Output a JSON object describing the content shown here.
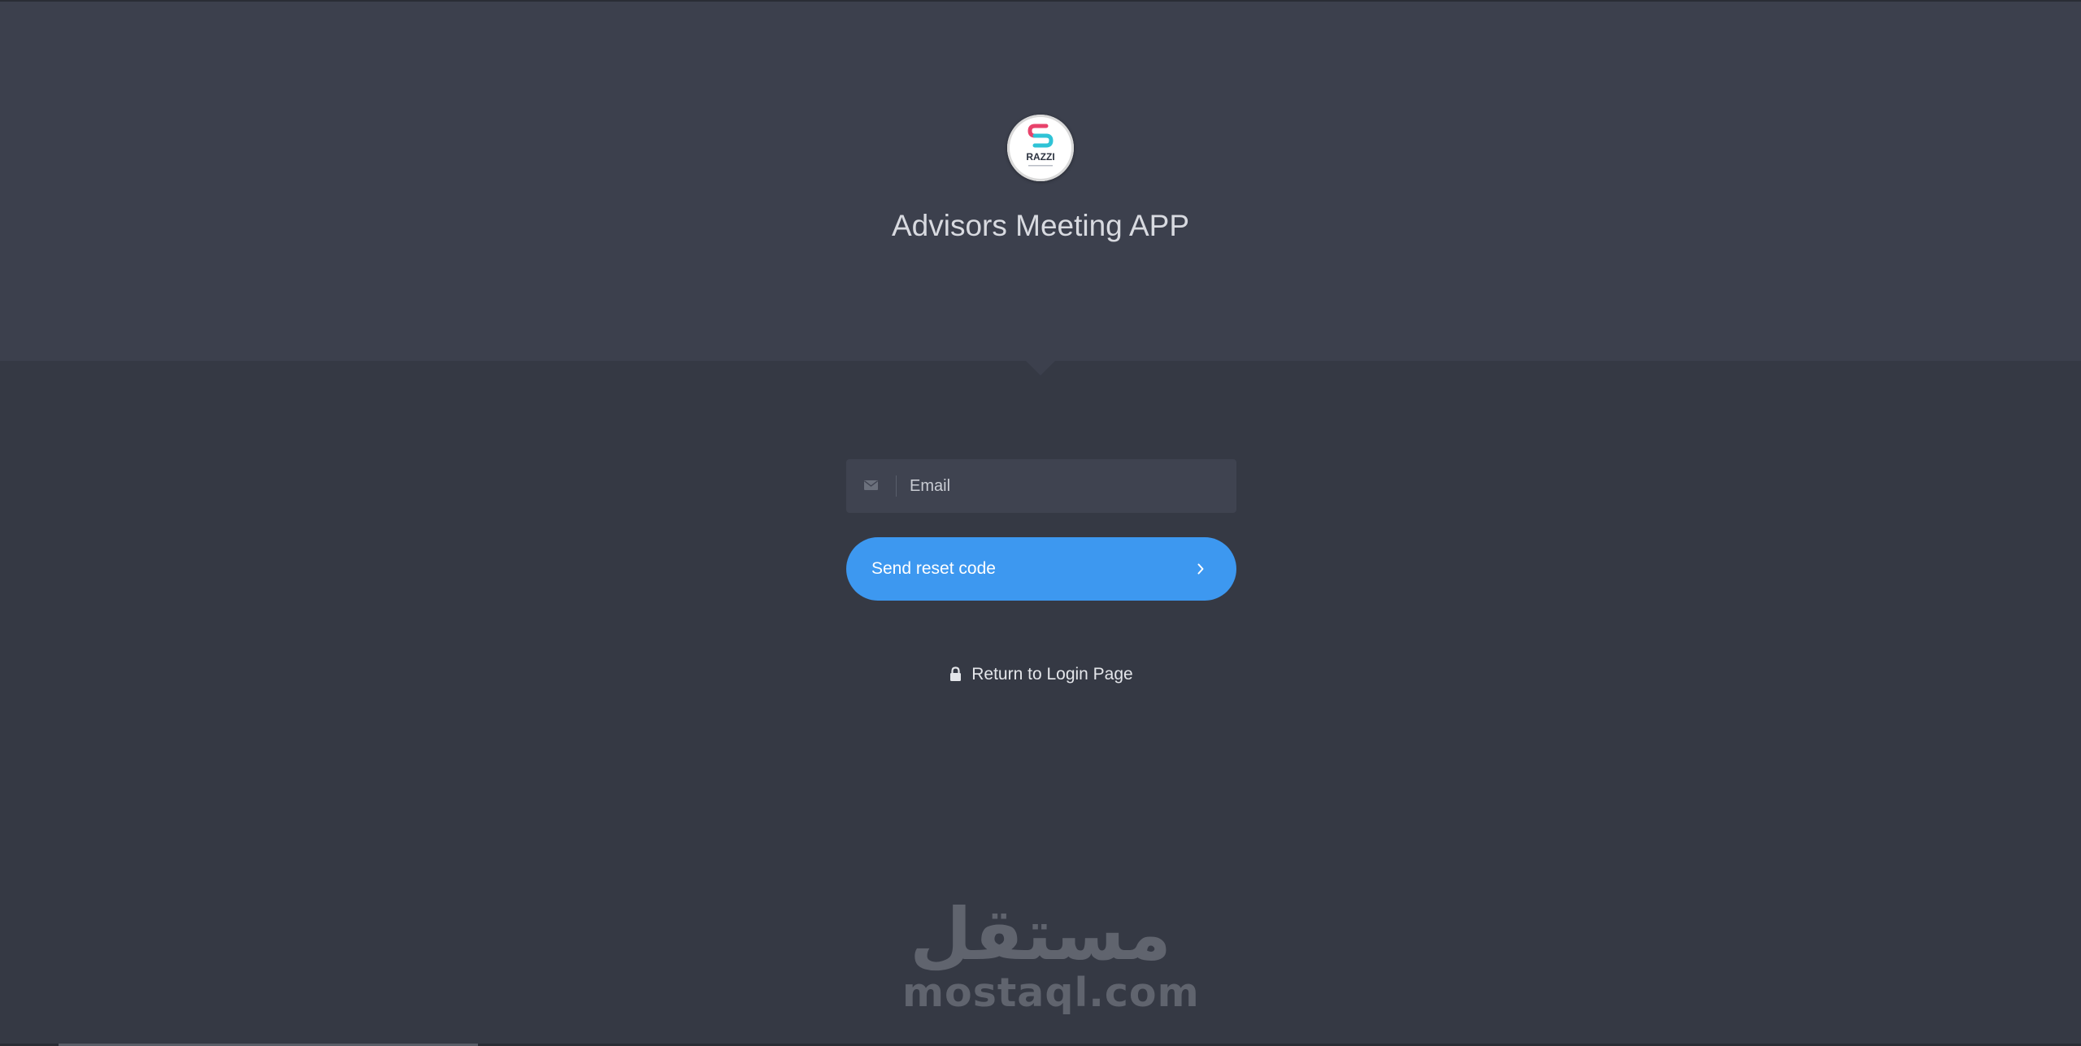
{
  "header": {
    "app_title": "Advisors Meeting APP",
    "logo_text": "RAZZI"
  },
  "form": {
    "email": {
      "placeholder": "Email",
      "value": "",
      "icon": "envelope-icon"
    },
    "send_button": {
      "label": "Send reset code",
      "icon": "chevron-right-icon"
    },
    "return_link": {
      "label": "Return to Login Page",
      "icon": "lock-icon"
    }
  },
  "watermark": {
    "arabic": "مستقل",
    "latin": "mostaql.com"
  },
  "colors": {
    "header_bg": "#3c404d",
    "body_bg": "#353944",
    "accent": "#3d98f0",
    "input_bg": "#3f4350",
    "text": "#e4e6ea"
  }
}
